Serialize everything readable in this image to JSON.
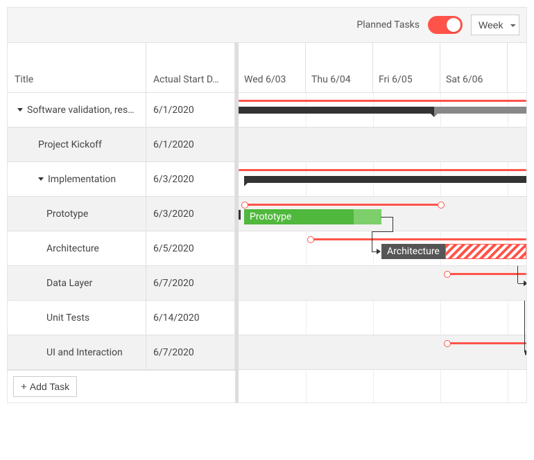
{
  "toolbar": {
    "planned_label": "Planned Tasks",
    "planned_on": true,
    "view_selected": "Week"
  },
  "columns": {
    "title": "Title",
    "actual_start": "Actual Start D…"
  },
  "timeline": {
    "days": [
      "Wed 6/03",
      "Thu 6/04",
      "Fri 6/05",
      "Sat 6/06"
    ]
  },
  "tasks": [
    {
      "id": "root",
      "title": "Software validation, res…",
      "start": "6/1/2020",
      "level": 1,
      "expandable": true
    },
    {
      "id": "kick",
      "title": "Project Kickoff",
      "start": "6/1/2020",
      "level": 2,
      "expandable": false
    },
    {
      "id": "impl",
      "title": "Implementation",
      "start": "6/3/2020",
      "level": 2,
      "expandable": true
    },
    {
      "id": "proto",
      "title": "Prototype",
      "start": "6/3/2020",
      "level": 3,
      "expandable": false
    },
    {
      "id": "arch",
      "title": "Architecture",
      "start": "6/5/2020",
      "level": 3,
      "expandable": false
    },
    {
      "id": "data",
      "title": "Data Layer",
      "start": "6/7/2020",
      "level": 3,
      "expandable": false
    },
    {
      "id": "unit",
      "title": "Unit Tests",
      "start": "6/14/2020",
      "level": 3,
      "expandable": false
    },
    {
      "id": "ui",
      "title": "UI and Interaction",
      "start": "6/7/2020",
      "level": 3,
      "expandable": false
    }
  ],
  "bars": {
    "prototype_label": "Prototype",
    "architecture_label": "Architecture"
  },
  "footer": {
    "add_task": "Add Task"
  },
  "colors": {
    "accent": "#ff5349",
    "green": "#4fb83d",
    "green_light": "#7dcf6b",
    "summary": "#333333",
    "summary_gray": "#888888"
  }
}
